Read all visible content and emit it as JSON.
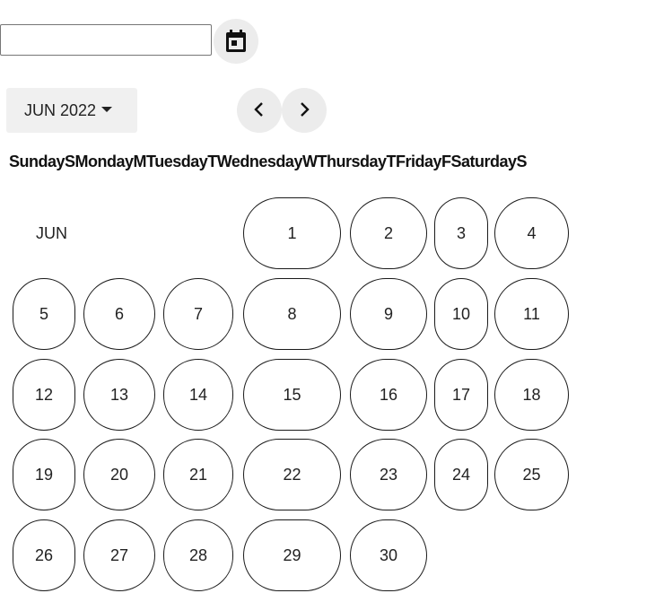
{
  "date_input": {
    "value": "",
    "placeholder": ""
  },
  "toggle": {
    "icon": "calendar-icon"
  },
  "header": {
    "month_year": "JUN 2022",
    "prev_icon": "chevron-left-icon",
    "next_icon": "chevron-right-icon"
  },
  "weekdays": [
    {
      "full": "Sunday",
      "short": "S"
    },
    {
      "full": "Monday",
      "short": "M"
    },
    {
      "full": "Tuesday",
      "short": "T"
    },
    {
      "full": "Wednesday",
      "short": "W"
    },
    {
      "full": "Thursday",
      "short": "T"
    },
    {
      "full": "Friday",
      "short": "F"
    },
    {
      "full": "Saturday",
      "short": "S"
    }
  ],
  "grid": {
    "month_label": "JUN",
    "days": [
      "1",
      "2",
      "3",
      "4",
      "5",
      "6",
      "7",
      "8",
      "9",
      "10",
      "11",
      "12",
      "13",
      "14",
      "15",
      "16",
      "17",
      "18",
      "19",
      "20",
      "21",
      "22",
      "23",
      "24",
      "25",
      "26",
      "27",
      "28",
      "29",
      "30"
    ]
  }
}
